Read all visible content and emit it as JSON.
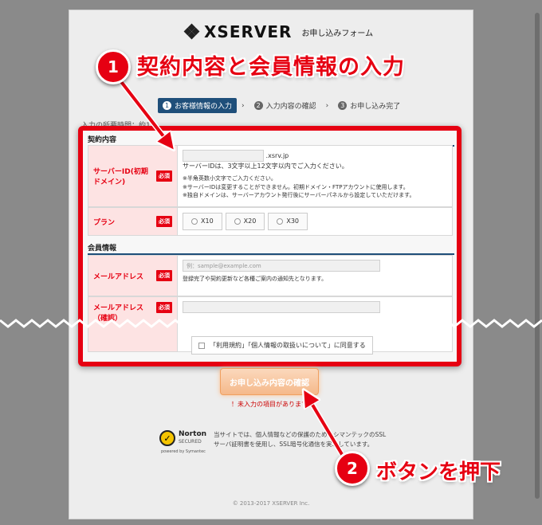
{
  "header": {
    "brand": "XSERVER",
    "form_title": "お申し込みフォーム"
  },
  "annotations": {
    "step1_number": "1",
    "step1_title": "契約内容と会員情報の入力",
    "step2_number": "2",
    "step2_title": "ボタンを押下"
  },
  "steps": [
    {
      "num": "1",
      "label": "お客様情報の入力"
    },
    {
      "num": "2",
      "label": "入力内容の確認"
    },
    {
      "num": "3",
      "label": "お申し込み完了"
    }
  ],
  "notice": "入力の所要時間：約1分",
  "contract": {
    "heading": "契約内容",
    "server_id": {
      "label": "サーバーID(初期ドメイン)",
      "required": "必須",
      "suffix": ".xsrv.jp",
      "hint": "サーバーIDは、3文字以上12文字以内でご入力ください。",
      "note1": "※半角英数小文字でご入力ください。",
      "note2": "※サーバーIDは変更することができません。初期ドメイン・FTPアカウントに使用します。",
      "note3": "※独自ドメインは、サーバーアカウント発行後にサーバーパネルから設定していただけます。"
    },
    "plan": {
      "label": "プラン",
      "required": "必須",
      "options": [
        "X10",
        "X20",
        "X30"
      ]
    }
  },
  "member": {
    "heading": "会員情報",
    "email": {
      "label": "メールアドレス",
      "required": "必須",
      "placeholder": "例：sample@example.com",
      "hint": "登録完了や契約更新など各種ご案内の通知先となります。"
    },
    "email_confirm": {
      "label": "メールアドレス（確認）",
      "required": "必須"
    },
    "agreement": "「利用規約」「個人情報の取扱いについて」に同意する"
  },
  "confirm_button": "お申し込み内容の確認",
  "warning": "！未入力の項目があります",
  "norton": {
    "name": "Norton",
    "secured": "SECURED",
    "powered": "powered by Symantec"
  },
  "ssl_text": "当サイトでは、個人情報などの保護のためにシマンテックのSSLサーバ証明書を使用し、SSL暗号化通信を実現しています。",
  "copyright": "© 2013-2017 XSERVER Inc.",
  "colors": {
    "accent": "#e60012",
    "navy": "#1f4f7a"
  }
}
